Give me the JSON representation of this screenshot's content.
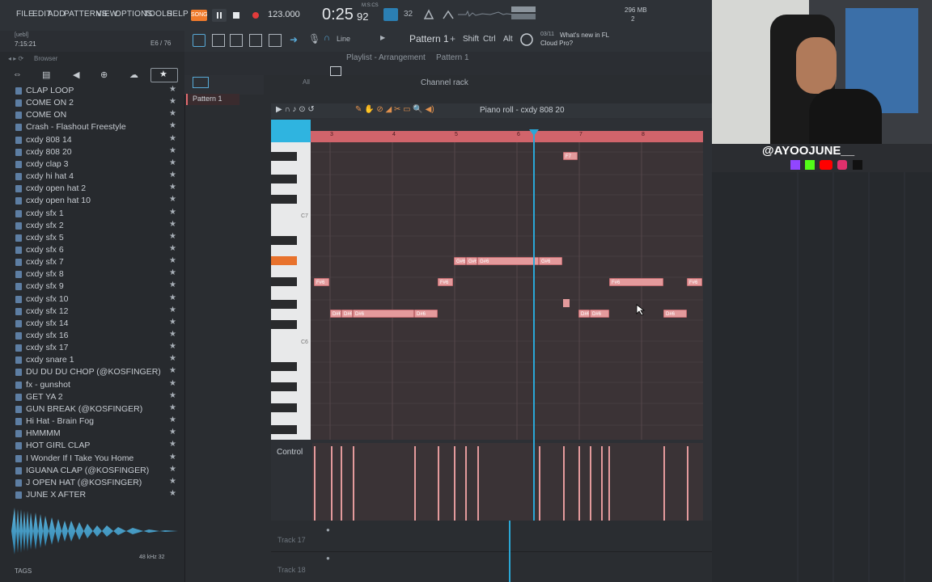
{
  "menu": {
    "items": [
      "FILE",
      "EDIT",
      "ADD",
      "PATTERNS",
      "VIEW",
      "OPTIONS",
      "TOOLS",
      "HELP"
    ]
  },
  "transport": {
    "mode": "SONG",
    "tempo": "123.000",
    "time": "0:25",
    "time_fraction": "92",
    "time_unit": "M:S:CS",
    "cpu_top": "296 MB",
    "cpu_bottom": "2"
  },
  "hint": {
    "line1": "[uebl]",
    "line2": "7:15:21",
    "ratio": "E6 / 76"
  },
  "toolbar2": {
    "snap": "Line",
    "pattern": "Pattern 1",
    "shift": "Shift",
    "ctrl": "Ctrl",
    "alt": "Alt",
    "news_date": "03/11",
    "news_text1": "What's new in FL",
    "news_text2": "Cloud Pro?"
  },
  "browser": {
    "title": "Browser",
    "pattern_tag": "Pattern 1",
    "items": [
      "CLAP LOOP",
      "COME ON 2",
      "COME ON",
      "Crash - Flashout Freestyle",
      "cxdy 808 14",
      "cxdy 808 20",
      "cxdy clap 3",
      "cxdy hi hat 4",
      "cxdy open hat 2",
      "cxdy open hat 10",
      "cxdy sfx 1",
      "cxdy sfx 2",
      "cxdy sfx 5",
      "cxdy sfx 6",
      "cxdy sfx 7",
      "cxdy sfx 8",
      "cxdy sfx 9",
      "cxdy sfx 10",
      "cxdy sfx 12",
      "cxdy sfx 14",
      "cxdy sfx 16",
      "cxdy sfx 17",
      "cxdy snare 1",
      "DU DU DU CHOP (@KOSFINGER)",
      "fx - gunshot",
      "GET YA 2",
      "GUN BREAK (@KOSFINGER)",
      "Hi Hat - Brain Fog",
      "HMMMM",
      "HOT GIRL CLAP",
      "I Wonder If I Take You Home",
      "IGUANA CLAP (@KOSFINGER)",
      "J OPEN HAT (@KOSFINGER)",
      "JUNE X AFTER"
    ],
    "sample_rate": "48 kHz 32",
    "tags_label": "TAGS"
  },
  "playlist": {
    "breadcrumb": "Playlist - Arrangement",
    "pattern": "Pattern 1",
    "all_label": "All",
    "channel_rack": "Channel rack"
  },
  "piano_roll": {
    "title": "Piano roll - cxdy 808 20",
    "bars": [
      "3",
      "4",
      "5",
      "6",
      "7",
      "8"
    ],
    "oct_c7": "C7",
    "oct_c6": "C6",
    "control_label": "Control",
    "note_labels": [
      "F7",
      "G#6",
      "G#6",
      "G#6",
      "G#6",
      "F#6",
      "F#6",
      "F#6",
      "F#6",
      "D#6",
      "D#6",
      "D#6",
      "D#6",
      "D#6",
      "D#6",
      "D#6"
    ]
  },
  "tracks": {
    "track17": "Track 17",
    "track18": "Track 18"
  },
  "stream": {
    "handle": "@AYOOJUNE__"
  },
  "colors": {
    "note": "#e49a9c",
    "playhead": "#2aa7d6",
    "ruler": "#d1646b",
    "highlight_key": "#e8722c"
  }
}
